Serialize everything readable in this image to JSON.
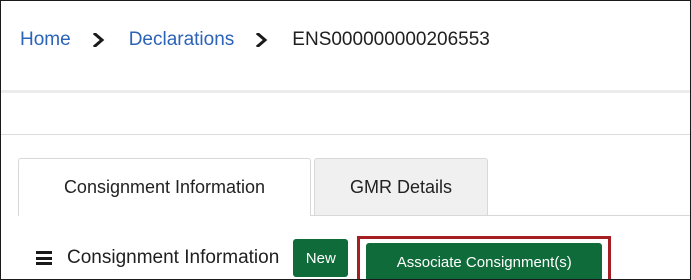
{
  "breadcrumb": {
    "home": "Home",
    "declarations": "Declarations",
    "current": "ENS000000000206553"
  },
  "tabs": [
    {
      "label": "Consignment Information",
      "active": true
    },
    {
      "label": "GMR Details",
      "active": false
    }
  ],
  "section": {
    "title": "Consignment Information",
    "new_button": "New",
    "associate_button": "Associate Consignment(s)"
  },
  "colors": {
    "link": "#2b63b8",
    "primary_button": "#0f6b3a",
    "highlight_border": "#a41e22"
  },
  "icons": {
    "separator": "chevron-right-icon",
    "menu": "hamburger-menu-icon"
  }
}
